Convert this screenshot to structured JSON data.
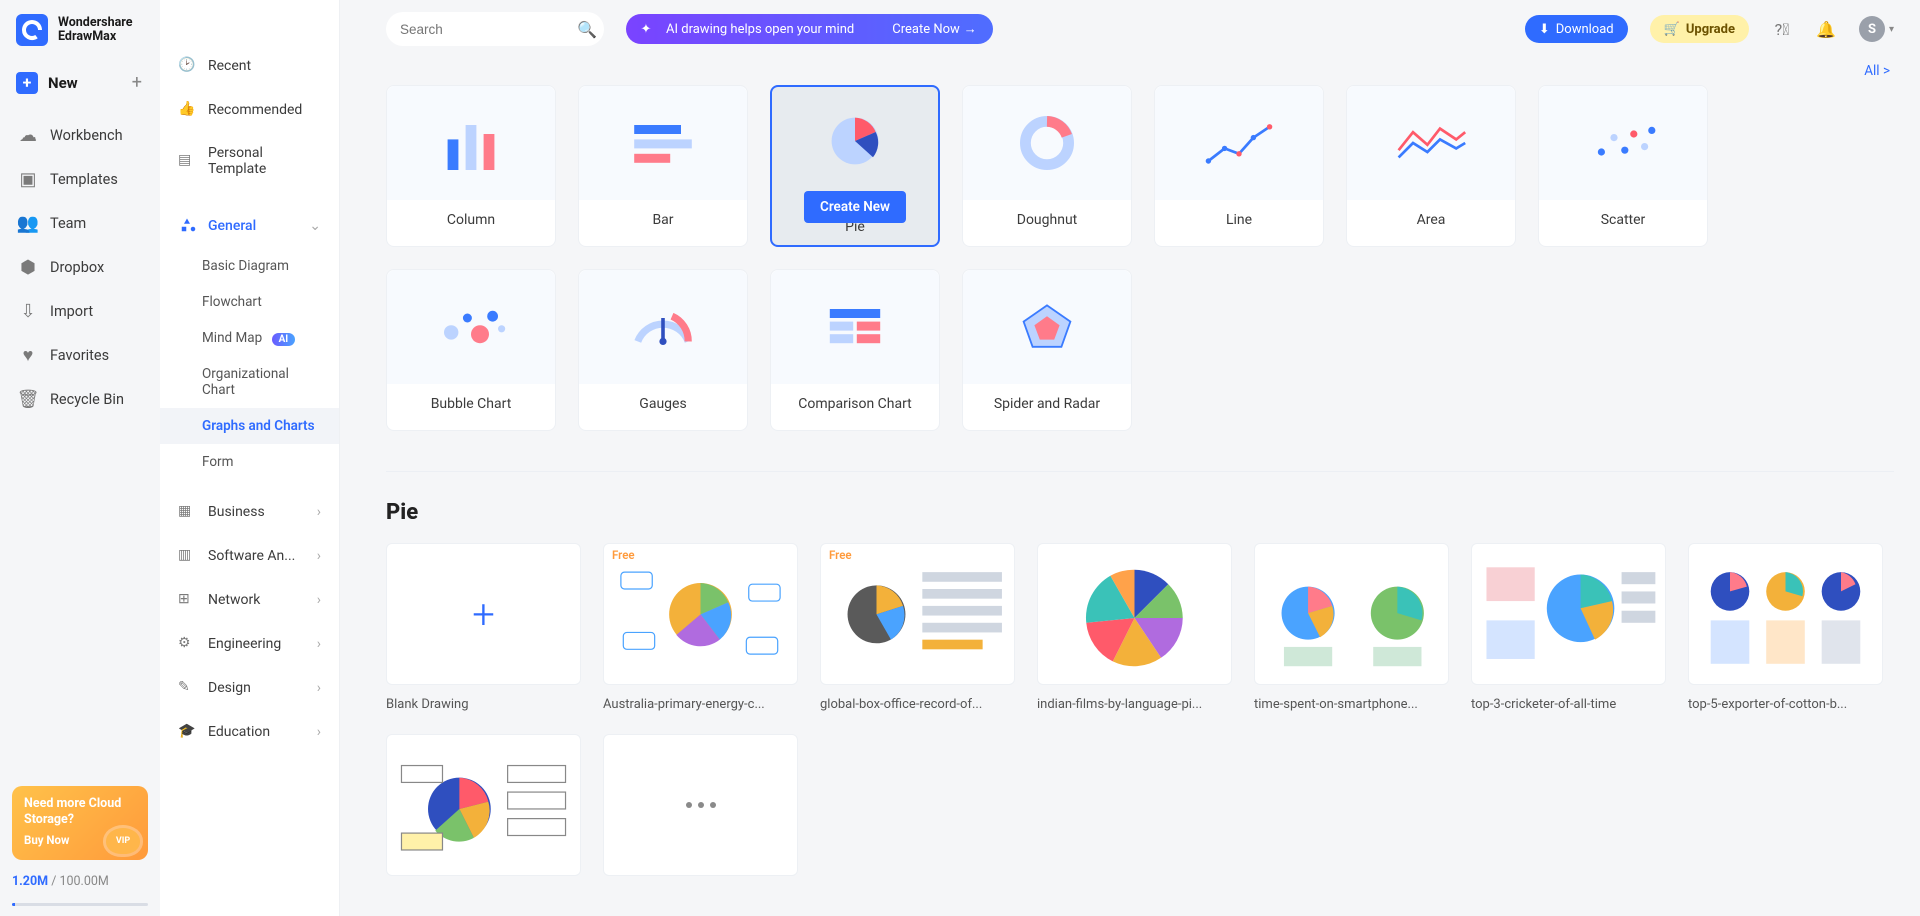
{
  "brand": {
    "line1": "Wondershare",
    "line2": "EdrawMax"
  },
  "newButton": {
    "label": "New"
  },
  "leftNav": [
    {
      "id": "workbench",
      "label": "Workbench"
    },
    {
      "id": "templates",
      "label": "Templates"
    },
    {
      "id": "team",
      "label": "Team"
    },
    {
      "id": "dropbox",
      "label": "Dropbox"
    },
    {
      "id": "import",
      "label": "Import"
    },
    {
      "id": "favorites",
      "label": "Favorites"
    },
    {
      "id": "recyclebin",
      "label": "Recycle Bin"
    }
  ],
  "promo": {
    "line1": "Need more Cloud Storage?",
    "cta": "Buy Now",
    "vip": "VIP"
  },
  "storage": {
    "used": "1.20M",
    "separator": " / ",
    "total": "100.00M"
  },
  "midTop": [
    {
      "id": "recent",
      "label": "Recent"
    },
    {
      "id": "recommended",
      "label": "Recommended"
    },
    {
      "id": "personaltemplate",
      "label": "Personal Template"
    }
  ],
  "generalSection": {
    "label": "General",
    "subs": [
      {
        "id": "basic",
        "label": "Basic Diagram"
      },
      {
        "id": "flowchart",
        "label": "Flowchart"
      },
      {
        "id": "mindmap",
        "label": "Mind Map",
        "ai": "AI"
      },
      {
        "id": "orgchart",
        "label": "Organizational Chart"
      },
      {
        "id": "graphs",
        "label": "Graphs and Charts",
        "active": true
      },
      {
        "id": "form",
        "label": "Form"
      }
    ]
  },
  "midBottom": [
    {
      "id": "business",
      "label": "Business"
    },
    {
      "id": "softwarean",
      "label": "Software An..."
    },
    {
      "id": "network",
      "label": "Network"
    },
    {
      "id": "engineering",
      "label": "Engineering"
    },
    {
      "id": "design",
      "label": "Design"
    },
    {
      "id": "education",
      "label": "Education"
    }
  ],
  "search": {
    "placeholder": "Search"
  },
  "aiBanner": {
    "text": "AI drawing helps open your mind",
    "cta": "Create Now"
  },
  "topButtons": {
    "download": "Download",
    "upgrade": "Upgrade"
  },
  "avatar": {
    "initial": "S"
  },
  "allLink": "All >",
  "chartTypes": [
    {
      "id": "column",
      "label": "Column"
    },
    {
      "id": "bar",
      "label": "Bar"
    },
    {
      "id": "pie",
      "label": "Pie",
      "selected": true,
      "createLabel": "Create New"
    },
    {
      "id": "doughnut",
      "label": "Doughnut"
    },
    {
      "id": "line",
      "label": "Line"
    },
    {
      "id": "area",
      "label": "Area"
    },
    {
      "id": "scatter",
      "label": "Scatter"
    },
    {
      "id": "bubble",
      "label": "Bubble Chart"
    },
    {
      "id": "gauges",
      "label": "Gauges"
    },
    {
      "id": "comparison",
      "label": "Comparison Chart"
    },
    {
      "id": "spider",
      "label": "Spider and Radar"
    }
  ],
  "sectionTitle": "Pie",
  "templates": [
    {
      "id": "blank",
      "label": "Blank Drawing",
      "blank": true
    },
    {
      "id": "t1",
      "label": "Australia-primary-energy-c...",
      "free": true
    },
    {
      "id": "t2",
      "label": "global-box-office-record-of...",
      "free": true
    },
    {
      "id": "t3",
      "label": "indian-films-by-language-pi..."
    },
    {
      "id": "t4",
      "label": "time-spent-on-smartphone..."
    },
    {
      "id": "t5",
      "label": "top-3-cricketer-of-all-time"
    },
    {
      "id": "t6",
      "label": "top-5-exporter-of-cotton-b..."
    },
    {
      "id": "t7",
      "label": ""
    },
    {
      "id": "more",
      "label": "",
      "more": true
    }
  ],
  "freeTag": "Free"
}
